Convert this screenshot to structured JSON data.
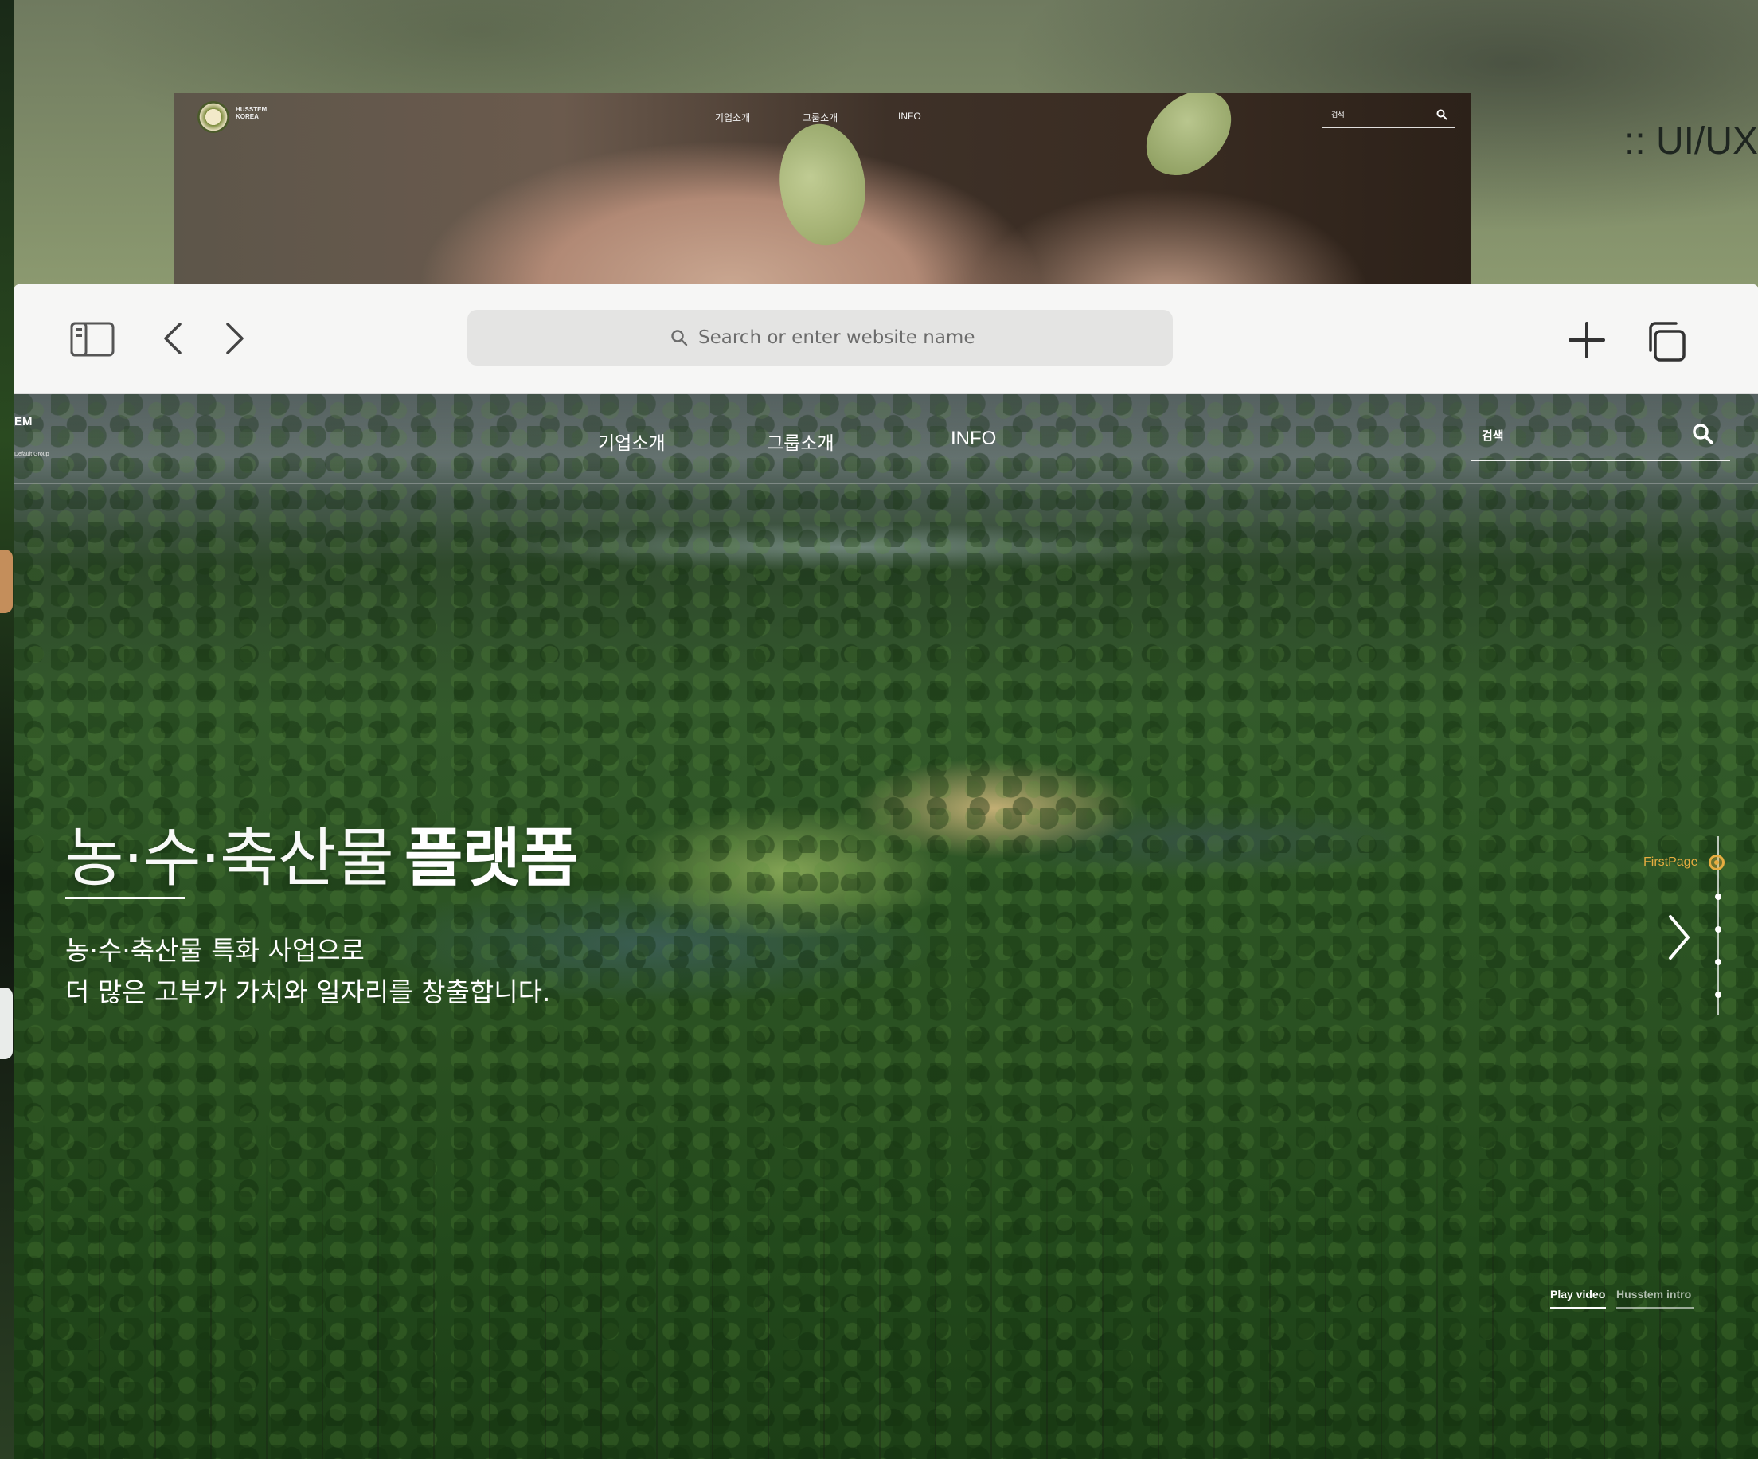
{
  "backdrop": {
    "side_label": ":: UI/UX"
  },
  "preview_window": {
    "logo_text_line1": "HUSSTEM",
    "logo_text_line2": "KOREA",
    "nav": [
      "기업소개",
      "그룹소개",
      "INFO"
    ],
    "search_placeholder": "검색"
  },
  "browser": {
    "address_placeholder": "Search or enter website name",
    "icons": [
      "sidebar-icon",
      "back-icon",
      "forward-icon",
      "new-tab-icon",
      "tabs-overview-icon"
    ]
  },
  "site": {
    "brand_cut": "EM",
    "brand_sub": "Default Group",
    "nav": [
      "기업소개",
      "그룹소개",
      "INFO"
    ],
    "search_placeholder": "검색",
    "hero": {
      "title_light": "농·수·축산물",
      "title_bold": "플랫폼",
      "subtitle_line1": "농·수·축산물 특화 사업으로",
      "subtitle_line2": "더 많은 고부가 가치와 일자리를 창출합니다."
    },
    "pager": {
      "active_label": "FirstPage",
      "count": 5,
      "active_index": 0
    },
    "bottom_tabs": {
      "active": "Play video",
      "inactive": "Husstem intro"
    },
    "colors": {
      "accent": "#e6ad40",
      "text": "#ffffff"
    }
  }
}
